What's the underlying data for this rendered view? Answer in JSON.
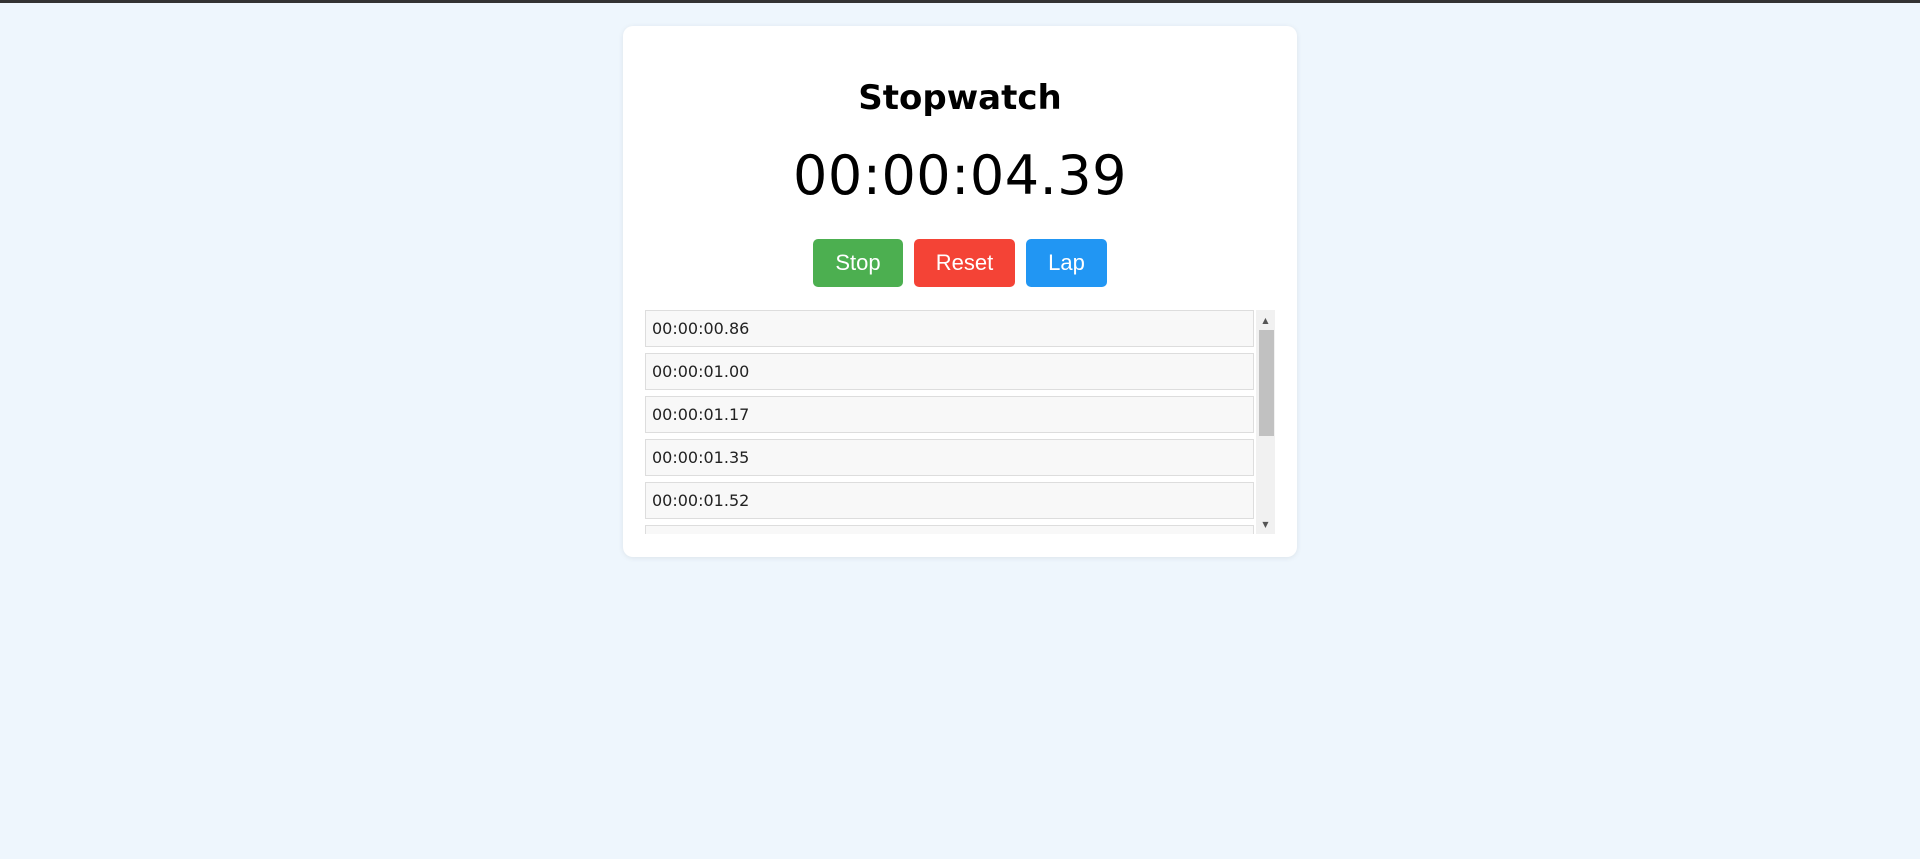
{
  "app": {
    "title": "Stopwatch",
    "time_display": "00:00:04.39"
  },
  "controls": {
    "stop_label": "Stop",
    "reset_label": "Reset",
    "lap_label": "Lap"
  },
  "laps": [
    "00:00:00.86",
    "00:00:01.00",
    "00:00:01.17",
    "00:00:01.35",
    "00:00:01.52",
    ""
  ],
  "icons": {
    "scroll_up": "▲",
    "scroll_down": "▼"
  },
  "colors": {
    "stop": "#4caf50",
    "reset": "#f44336",
    "lap": "#2196f3"
  }
}
